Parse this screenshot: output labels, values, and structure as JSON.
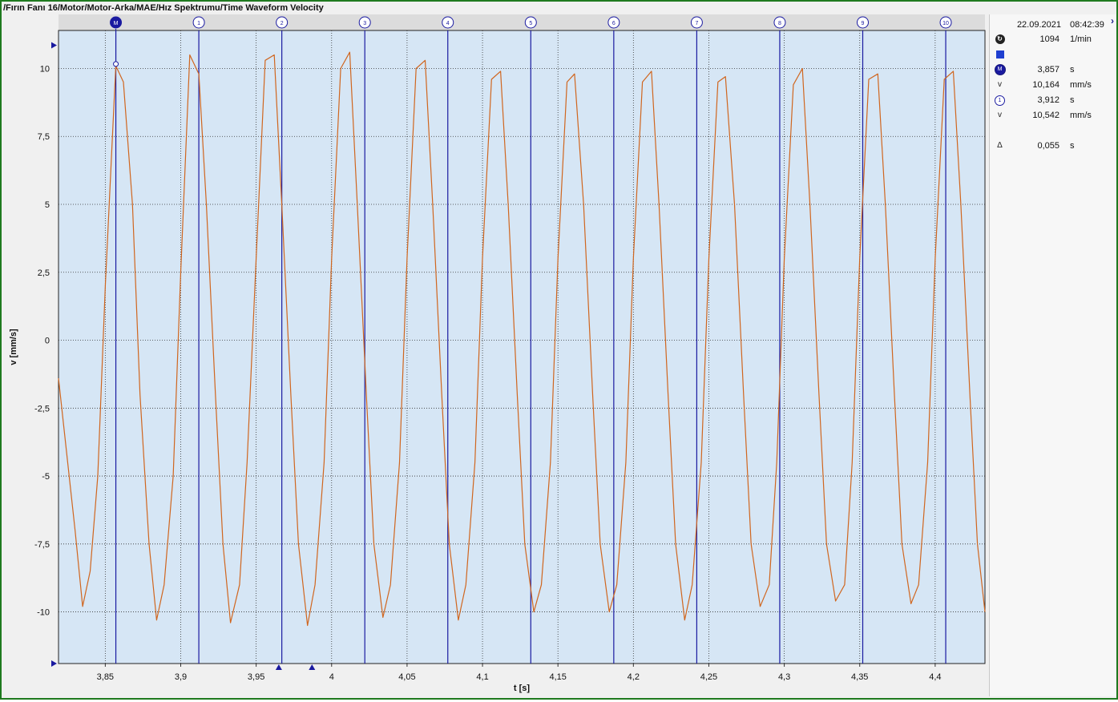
{
  "window": {
    "title": "/Fırın Fanı 16/Motor/Motor-Arka/MAE/Hız Spektrumu/Time Waveform Velocity"
  },
  "chart_data": {
    "type": "line",
    "xlabel": "t [s]",
    "ylabel": "v [mm/s]",
    "xlim": [
      3.819,
      4.433
    ],
    "ylim": [
      -11.9,
      11.4
    ],
    "xticks": [
      3.85,
      3.9,
      3.95,
      4.0,
      4.05,
      4.1,
      4.15,
      4.2,
      4.25,
      4.3,
      4.35,
      4.4
    ],
    "xtick_labels": [
      "3,85",
      "3,9",
      "3,95",
      "4",
      "4,05",
      "4,1",
      "4,15",
      "4,2",
      "4,25",
      "4,3",
      "4,35",
      "4,4"
    ],
    "yticks": [
      10,
      7.5,
      5,
      2.5,
      0,
      -2.5,
      -5,
      -7.5,
      -10
    ],
    "ytick_labels": [
      "10",
      "7,5",
      "5",
      "2,5",
      "0",
      "-2,5",
      "-5",
      "-7,5",
      "-10"
    ],
    "grid": true,
    "series": [
      {
        "name": "",
        "color": "#d0661f",
        "x": [
          3.819,
          3.83,
          3.83,
          3.835,
          3.84,
          3.845,
          3.85,
          3.857,
          3.862,
          3.868,
          3.873,
          3.879,
          3.884,
          3.889,
          3.895,
          3.9,
          3.906,
          3.912,
          3.917,
          3.923,
          3.928,
          3.933,
          3.939,
          3.944,
          3.95,
          3.956,
          3.962,
          3.967,
          3.973,
          3.978,
          3.984,
          3.989,
          3.995,
          4.0,
          4.006,
          4.012,
          4.017,
          4.023,
          4.028,
          4.034,
          4.039,
          4.045,
          4.05,
          4.056,
          4.062,
          4.067,
          4.073,
          4.078,
          4.084,
          4.089,
          4.095,
          4.1,
          4.106,
          4.112,
          4.117,
          4.123,
          4.128,
          4.134,
          4.139,
          4.145,
          4.15,
          4.156,
          4.161,
          4.167,
          4.173,
          4.178,
          4.184,
          4.189,
          4.195,
          4.2,
          4.206,
          4.212,
          4.217,
          4.223,
          4.228,
          4.234,
          4.239,
          4.245,
          4.25,
          4.256,
          4.261,
          4.267,
          4.273,
          4.278,
          4.284,
          4.29,
          4.295,
          4.3,
          4.306,
          4.312,
          4.317,
          4.323,
          4.328,
          4.334,
          4.34,
          4.345,
          4.35,
          4.356,
          4.362,
          4.367,
          4.373,
          4.378,
          4.384,
          4.389,
          4.395,
          4.4,
          4.406,
          4.412,
          4.417,
          4.423,
          4.428,
          4.433
        ],
        "y": [
          -1.4,
          -7.0,
          -7.0,
          -9.8,
          -8.5,
          -5.0,
          2.0,
          10.1,
          9.5,
          5.0,
          -2.0,
          -7.5,
          -10.3,
          -9.0,
          -5.0,
          2.5,
          10.5,
          9.8,
          5.0,
          -2.0,
          -7.5,
          -10.4,
          -9.0,
          -4.5,
          3.0,
          10.3,
          10.5,
          5.0,
          -2.0,
          -7.5,
          -10.5,
          -9.0,
          -4.5,
          3.0,
          10.0,
          10.6,
          5.0,
          -2.0,
          -7.5,
          -10.2,
          -9.0,
          -4.5,
          3.0,
          10.0,
          10.3,
          5.0,
          -2.0,
          -7.5,
          -10.3,
          -9.0,
          -4.5,
          3.0,
          9.6,
          9.9,
          5.0,
          -2.0,
          -7.5,
          -10.0,
          -9.0,
          -4.5,
          3.0,
          9.5,
          9.8,
          5.0,
          -2.0,
          -7.5,
          -10.0,
          -9.0,
          -4.5,
          3.0,
          9.5,
          9.9,
          5.0,
          -2.0,
          -7.5,
          -10.3,
          -9.0,
          -4.5,
          3.0,
          9.5,
          9.7,
          5.0,
          -2.0,
          -7.5,
          -9.8,
          -9.0,
          -4.5,
          3.0,
          9.4,
          10.0,
          5.0,
          -2.0,
          -7.5,
          -9.6,
          -9.0,
          -4.5,
          3.0,
          9.6,
          9.8,
          5.0,
          -2.0,
          -7.5,
          -9.7,
          -9.0,
          -4.5,
          3.0,
          9.6,
          9.9,
          5.0,
          -2.0,
          -7.5,
          -10.0
        ]
      }
    ],
    "cursors": [
      {
        "label": "M",
        "x": 3.857,
        "active": true
      },
      {
        "label": "1",
        "x": 3.912
      },
      {
        "label": "2",
        "x": 3.967
      },
      {
        "label": "3",
        "x": 4.022
      },
      {
        "label": "4",
        "x": 4.077
      },
      {
        "label": "5",
        "x": 4.132
      },
      {
        "label": "6",
        "x": 4.187
      },
      {
        "label": "7",
        "x": 4.242
      },
      {
        "label": "8",
        "x": 4.297
      },
      {
        "label": "9",
        "x": 4.352
      },
      {
        "label": "10",
        "x": 4.407
      }
    ],
    "marker_point": {
      "x": 3.857,
      "y": 10.164
    },
    "x_range_markers": [
      3.965,
      3.987
    ]
  },
  "panel": {
    "date": "22.09.2021",
    "time": "08:42:39",
    "rpm_value": "1094",
    "rpm_unit": "1/min",
    "cursor_m": {
      "t_value": "3,857",
      "t_unit": "s",
      "v_label": "v",
      "v_value": "10,164",
      "v_unit": "mm/s"
    },
    "cursor_1": {
      "t_value": "3,912",
      "t_unit": "s",
      "v_label": "v",
      "v_value": "10,542",
      "v_unit": "mm/s"
    },
    "delta": {
      "label": "Δ",
      "value": "0,055",
      "unit": "s"
    },
    "icons": {
      "rpm": "rpm-icon",
      "legend": "blue-square-icon",
      "m": "cursor-m-icon",
      "c1": "cursor-1-icon"
    },
    "m_icon_text": "M",
    "c1_icon_text": "1",
    "expand_icon": "›"
  }
}
